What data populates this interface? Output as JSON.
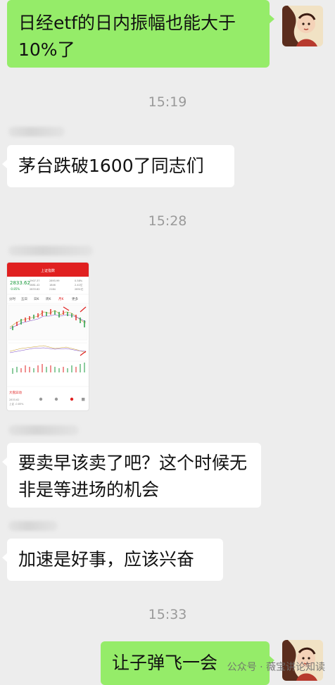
{
  "messages": {
    "m1": "日经etf的日内振幅也能大于10%了",
    "t1": "15:19",
    "m2": "茅台跌破1600了同志们",
    "t2": "15:28",
    "m3": "要卖早该卖了吧？这个时候无非是等进场的机会",
    "m4": "加速是好事，应该兴奋",
    "t3": "15:33",
    "m5": "让子弹飞一会"
  },
  "screenshot": {
    "header_title": "上证指数",
    "price": "2833.62",
    "price_change": "-0.85%",
    "tabs": [
      "分时",
      "五日",
      "日K",
      "周K",
      "月K",
      "更多"
    ],
    "bottom_tab": "大盘异动"
  },
  "watermark": "公众号 · 薇宝讲论知读",
  "colors": {
    "chat_bg": "#ededed",
    "self_bubble": "#95ec69",
    "other_bubble": "#ffffff",
    "timestamp": "#9a9a9a",
    "stock_red": "#e02020",
    "stock_green": "#1a9a3c"
  }
}
